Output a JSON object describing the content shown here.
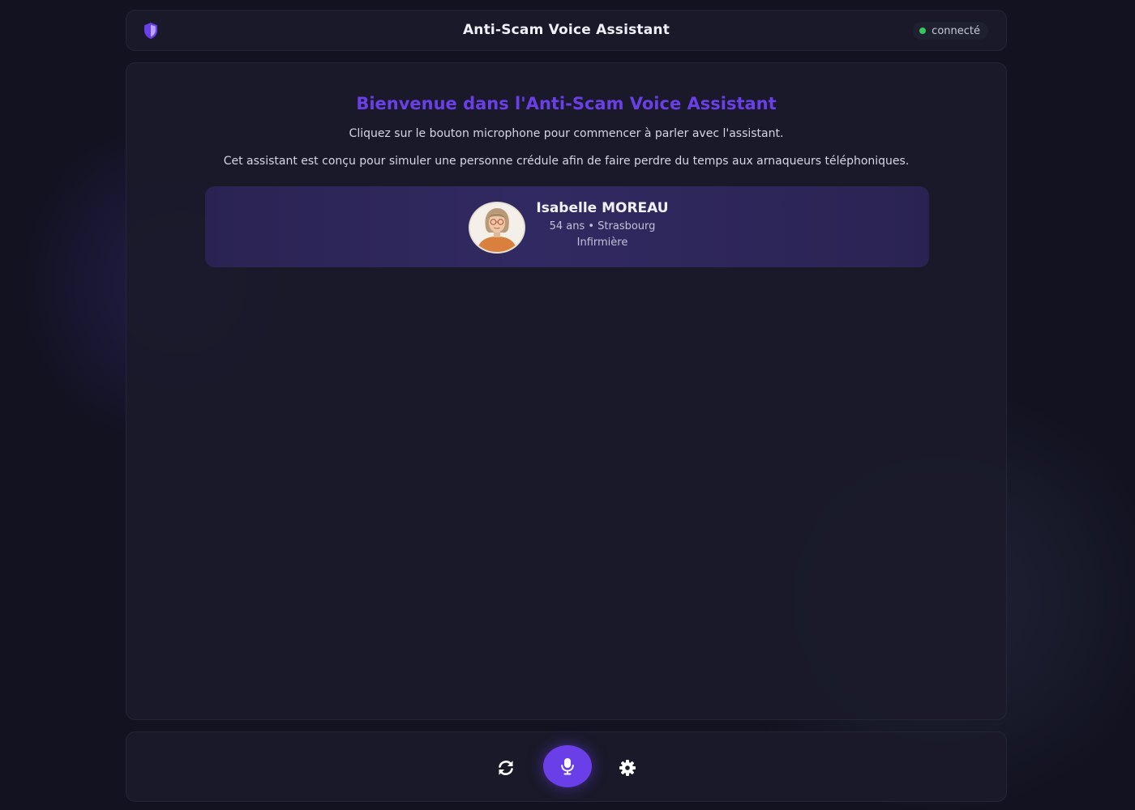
{
  "header": {
    "title": "Anti-Scam Voice Assistant",
    "logo_icon": "shield-icon",
    "status_label": "connecté",
    "status_color": "#34c759"
  },
  "welcome": {
    "title": "Bienvenue dans l'Anti-Scam Voice Assistant",
    "line1": "Cliquez sur le bouton microphone pour commencer à parler avec l'assistant.",
    "line2": "Cet assistant est conçu pour simuler une personne crédule afin de faire perdre du temps aux arnaqueurs téléphoniques."
  },
  "persona": {
    "name": "Isabelle MOREAU",
    "meta": "54 ans • Strasbourg",
    "job": "Infirmière",
    "avatar_icon": "persona-avatar"
  },
  "controls": {
    "refresh_icon": "refresh-icon",
    "mic_icon": "microphone-icon",
    "settings_icon": "gear-icon"
  },
  "colors": {
    "accent": "#6a3fe8",
    "background": "#121220",
    "panel": "#1a1a2a"
  }
}
